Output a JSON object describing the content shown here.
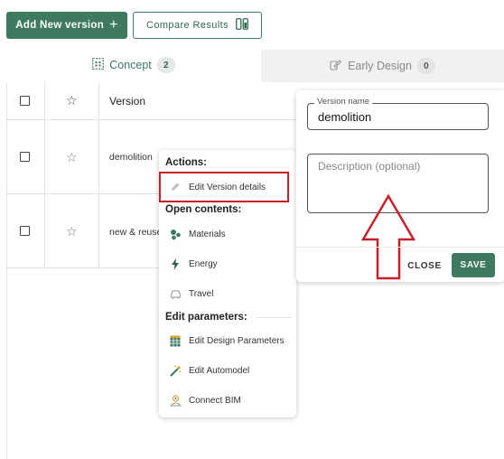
{
  "toolbar": {
    "add_label": "Add New version",
    "add_icon": "plus-icon",
    "compare_label": "Compare Results",
    "compare_icon": "compare-icon"
  },
  "tabs": [
    {
      "label": "Concept",
      "count": "2",
      "icon": "grid-building-icon",
      "active": true
    },
    {
      "label": "Early Design",
      "count": "0",
      "icon": "sketch-icon",
      "active": false
    }
  ],
  "table": {
    "header": {
      "version": "Version"
    },
    "rows": [
      {
        "name": "demolition"
      },
      {
        "name": "new & reuse"
      }
    ]
  },
  "menu": {
    "actions_title": "Actions:",
    "edit_version": "Edit Version details",
    "open_contents_title": "Open contents:",
    "materials": "Materials",
    "energy": "Energy",
    "travel": "Travel",
    "edit_parameters_title": "Edit parameters:",
    "edit_design_parameters": "Edit Design Parameters",
    "edit_automodel": "Edit Automodel",
    "connect_bim": "Connect BIM"
  },
  "dialog": {
    "name_label": "Version name",
    "name_value": "demolition",
    "description_placeholder": "Description (optional)",
    "close_label": "CLOSE",
    "save_label": "SAVE"
  },
  "colors": {
    "brand_green": "#3d7a5f",
    "annotation_red": "#c8202a"
  }
}
